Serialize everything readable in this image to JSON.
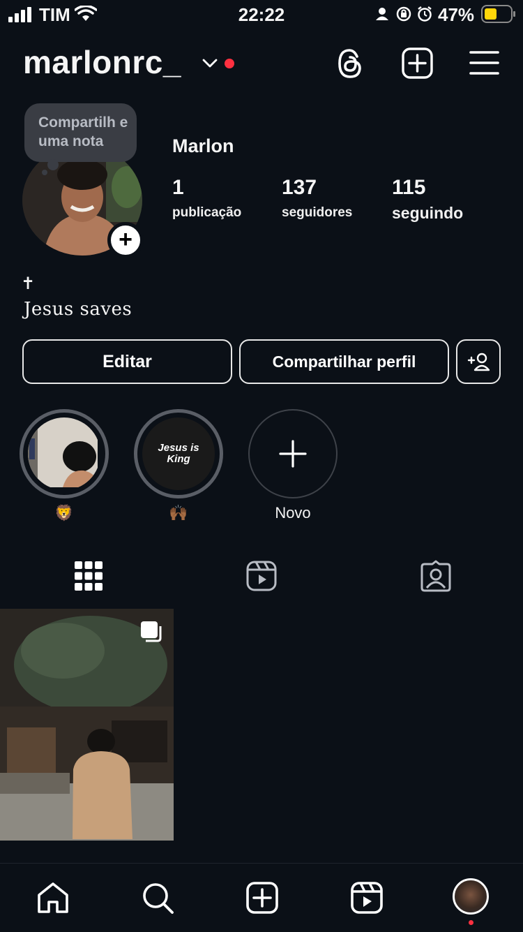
{
  "status_bar": {
    "carrier": "TIM",
    "time": "22:22",
    "battery_percent": "47%"
  },
  "header": {
    "username": "marlonrc_",
    "icons": [
      "chevron-down-icon",
      "threads-icon",
      "create-post-icon",
      "menu-icon"
    ]
  },
  "profile": {
    "note_text": "Compartilh e uma nota",
    "display_name": "Marlon",
    "stats": [
      {
        "value": "1",
        "label": "publicação"
      },
      {
        "value": "137",
        "label": "seguidores"
      },
      {
        "value": "115",
        "label": "seguindo"
      }
    ],
    "bio_icon": "✝",
    "bio": "Jesus saves"
  },
  "actions": {
    "edit_label": "Editar",
    "share_label": "Compartilhar perfil"
  },
  "highlights": [
    {
      "label": "🦁"
    },
    {
      "label": "🙌🏾",
      "cover_text": "Jesus is King"
    },
    {
      "label": "Novo"
    }
  ],
  "tabs": [
    "grid-icon",
    "reels-icon",
    "tagged-icon"
  ],
  "bottom_nav": [
    "home-icon",
    "search-icon",
    "create-icon",
    "reels-icon",
    "profile-avatar"
  ],
  "colors": {
    "background": "#0b1017",
    "accent_red": "#ff3040",
    "battery_yellow": "#ffd60a"
  }
}
